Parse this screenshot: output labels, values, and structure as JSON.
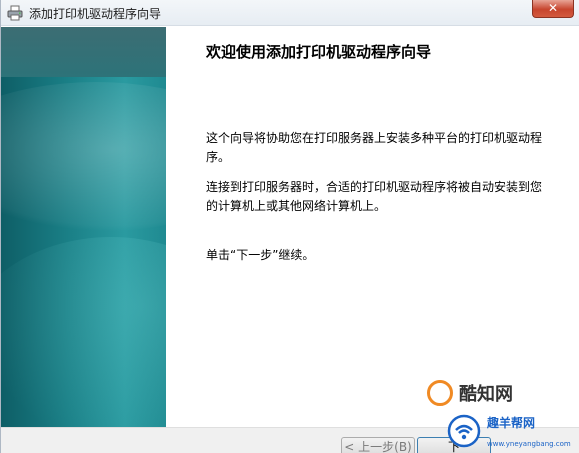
{
  "window": {
    "title": "添加打印机驱动程序向导",
    "close_glyph": "✕"
  },
  "content": {
    "heading": "欢迎使用添加打印机驱动程序向导",
    "paragraph1": "这个向导将协助您在打印服务器上安装多种平台的打印机驱动程序。",
    "paragraph2": "连接到打印服务器时，合适的打印机驱动程序将被自动安装到您的计算机上或其他网络计算机上。",
    "paragraph3": "单击“下一步”继续。"
  },
  "buttons": {
    "back_label": "< 上一步(B)",
    "next_label": "下"
  },
  "watermarks": {
    "logo_text": "酷知网",
    "site_name": "趣羊帮网",
    "site_url": "www.yneyangbang.com"
  },
  "colors": {
    "banner_teal": "#1a7f86",
    "close_red": "#c7452e",
    "watermark_orange": "#f08a24",
    "watermark_blue": "#1b63c6"
  },
  "icons": {
    "title": "printer-icon",
    "close": "close-icon",
    "watermark_logo": "kuzhi-logo-icon",
    "watermark_site": "wifi-logo-icon"
  }
}
